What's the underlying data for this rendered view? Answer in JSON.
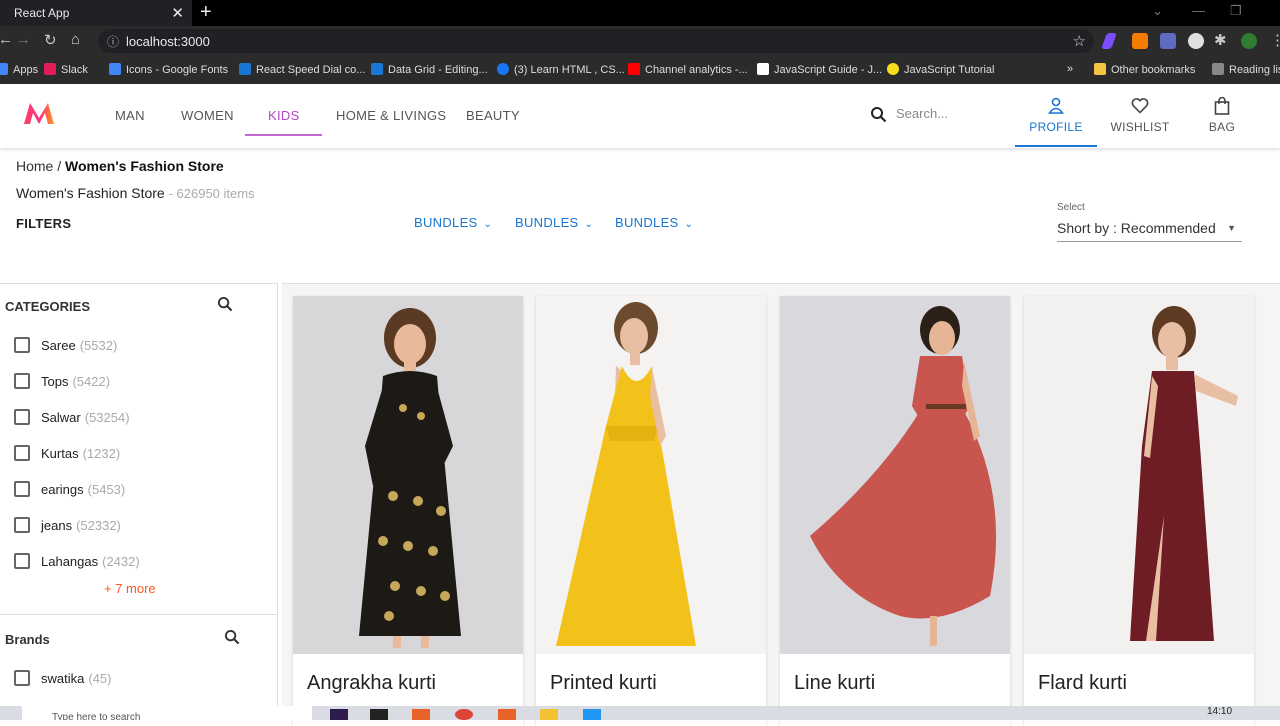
{
  "browser": {
    "tab_title": "React App",
    "url": "localhost:3000",
    "bookmarks": [
      {
        "label": "Apps",
        "color": "#4285f4"
      },
      {
        "label": "Slack",
        "color": "#e01e5a"
      },
      {
        "label": "Icons - Google Fonts",
        "color": "#4285f4"
      },
      {
        "label": "React Speed Dial co...",
        "color": "#1976d2"
      },
      {
        "label": "Data Grid - Editing...",
        "color": "#1976d2"
      },
      {
        "label": "(3) Learn HTML , CS...",
        "color": "#1877f2"
      },
      {
        "label": "Channel analytics -...",
        "color": "#ff0000"
      },
      {
        "label": "JavaScript Guide - J...",
        "color": "#ffffff"
      },
      {
        "label": "JavaScript Tutorial",
        "color": "#f7df1e"
      }
    ],
    "other_bookmarks": "Other bookmarks",
    "reading_list": "Reading list"
  },
  "header": {
    "nav": [
      "MAN",
      "WOMEN",
      "KIDS",
      "HOME & LIVINGS",
      "BEAUTY"
    ],
    "active_nav": "KIDS",
    "search_placeholder": "Search...",
    "actions": {
      "profile": "PROFILE",
      "wishlist": "WISHLIST",
      "bag": "BAG"
    },
    "accent": "#b546c7",
    "profile_color": "#1976d2"
  },
  "breadcrumb": {
    "home": "Home",
    "separator": "/",
    "current": "Women's Fashion Store"
  },
  "store": {
    "title": "Women's Fashion Store",
    "count": "- 626950 items"
  },
  "filters": {
    "label": "FILTERS",
    "bundles": [
      "BUNDLES",
      "BUNDLES",
      "BUNDLES"
    ]
  },
  "sort": {
    "caption": "Select",
    "value": "Short by : Recommended"
  },
  "categories": {
    "heading": "CATEGORIES",
    "items": [
      {
        "name": "Saree",
        "count": "(5532)"
      },
      {
        "name": "Tops",
        "count": "(5422)"
      },
      {
        "name": "Salwar",
        "count": "(53254)"
      },
      {
        "name": "Kurtas",
        "count": "(1232)"
      },
      {
        "name": "earings",
        "count": "(5453)"
      },
      {
        "name": "jeans",
        "count": "(52332)"
      },
      {
        "name": "Lahangas",
        "count": "(2432)"
      }
    ],
    "more": "+ 7 more"
  },
  "brands": {
    "heading": "Brands",
    "items": [
      {
        "name": "swatika",
        "count": "(45)"
      }
    ]
  },
  "products": [
    {
      "title": "Angrakha kurti",
      "bg": "#d7d7da",
      "dress": "#1d1a16",
      "pattern": "#c6a85a"
    },
    {
      "title": "Printed kurti",
      "bg": "#f4f3f1",
      "dress": "#f2c21a",
      "pattern": ""
    },
    {
      "title": "Line kurti",
      "bg": "#d9d8dc",
      "dress": "#c8554e",
      "pattern": ""
    },
    {
      "title": "Flard kurti",
      "bg": "#f2f1f0",
      "dress": "#6e1d24",
      "pattern": ""
    }
  ],
  "taskbar": {
    "search_placeholder": "Type here to search",
    "time": "14:10"
  }
}
